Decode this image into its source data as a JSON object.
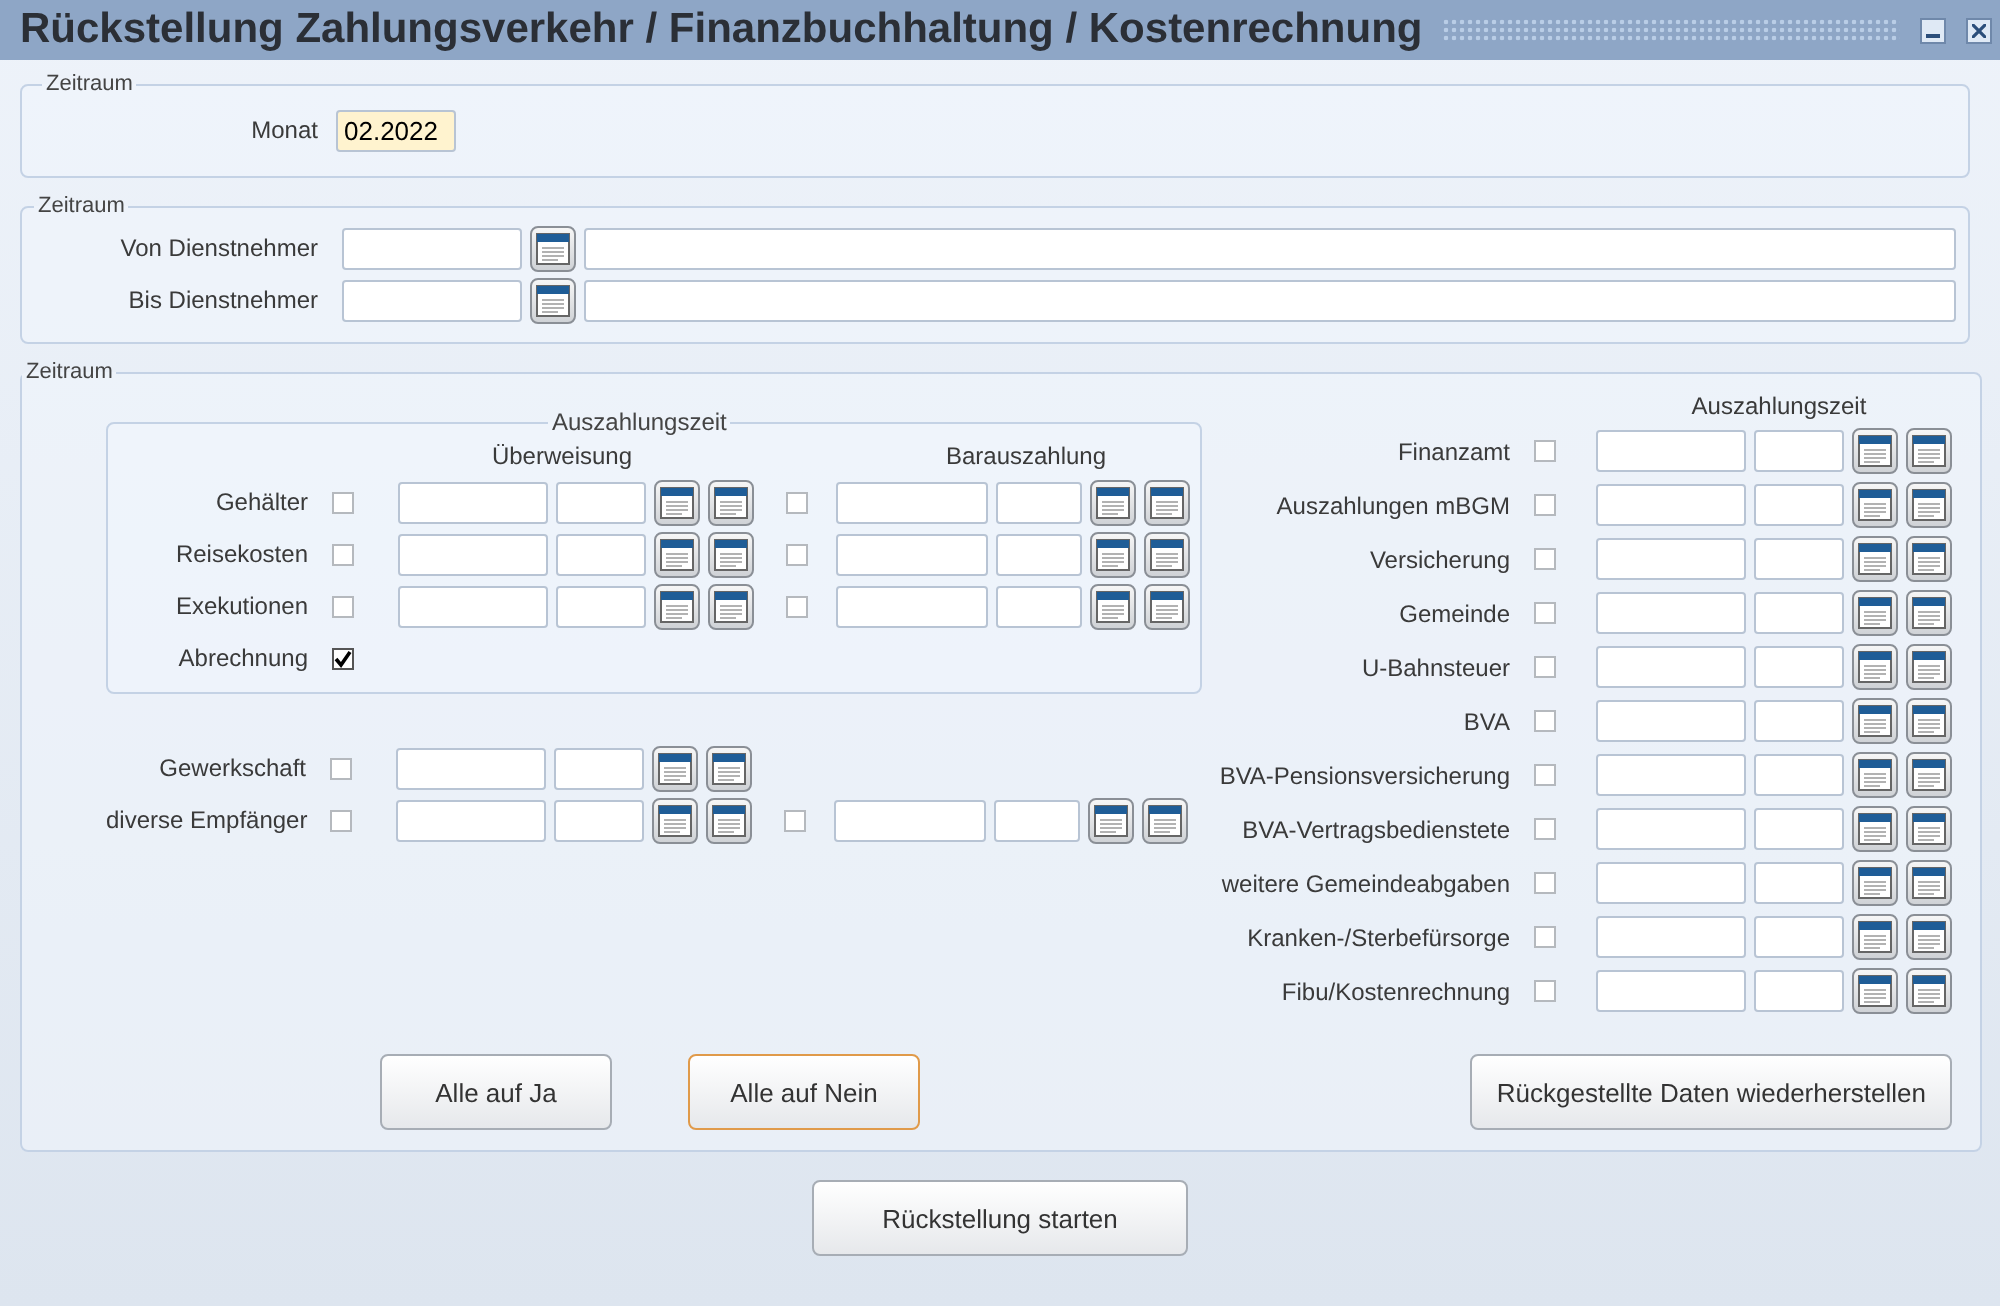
{
  "window": {
    "title": "Rückstellung Zahlungsverkehr / Finanzbuchhaltung / Kostenrechnung"
  },
  "period": {
    "legend": "Zeitraum",
    "label": "Monat",
    "value": "02.2022"
  },
  "employees": {
    "legend": "Zeitraum",
    "rows": [
      {
        "label": "Von Dienstnehmer"
      },
      {
        "label": "Bis Dienstnehmer"
      }
    ]
  },
  "payments": {
    "legend": "Zeitraum",
    "group": {
      "legend": "Auszahlungszeit",
      "columns": [
        "Überweisung",
        "Barauszahlung"
      ],
      "rows": [
        {
          "kind": "both",
          "label": "Gehälter",
          "checked": false,
          "cash_checked": false
        },
        {
          "kind": "both",
          "label": "Reisekosten",
          "checked": false,
          "cash_checked": false
        },
        {
          "kind": "both",
          "label": "Exekutionen",
          "checked": false,
          "cash_checked": false
        },
        {
          "kind": "checkbox",
          "label": "Abrechnung",
          "checked": true
        }
      ]
    },
    "extra_rows": [
      {
        "kind": "transfer",
        "label": "Gewerkschaft",
        "checked": false
      },
      {
        "kind": "both",
        "label": "diverse Empfänger",
        "checked": false,
        "cash_checked": false
      }
    ],
    "right": {
      "heading": "Auszahlungszeit",
      "rows": [
        {
          "label": "Finanzamt",
          "checked": false
        },
        {
          "label": "Auszahlungen mBGM",
          "checked": false
        },
        {
          "label": "Versicherung",
          "checked": false
        },
        {
          "label": "Gemeinde",
          "checked": false
        },
        {
          "label": "U-Bahnsteuer",
          "checked": false
        },
        {
          "label": "BVA",
          "checked": false
        },
        {
          "label": "BVA-Pensionsversicherung",
          "checked": false
        },
        {
          "label": "BVA-Vertragsbedienstete",
          "checked": false
        },
        {
          "label": "weitere Gemeindeabgaben",
          "checked": false
        },
        {
          "label": "Kranken-/Sterbefürsorge",
          "checked": false
        },
        {
          "label": "Fibu/Kostenrechnung",
          "checked": false
        }
      ]
    },
    "buttons": [
      {
        "label": "Alle auf Ja",
        "focused": false
      },
      {
        "label": "Alle auf Nein",
        "focused": true
      },
      {
        "label": "Rückgestellte Daten wiederherstellen",
        "focused": false
      }
    ]
  },
  "start_button": {
    "label": "Rückstellung starten",
    "focused": false
  }
}
